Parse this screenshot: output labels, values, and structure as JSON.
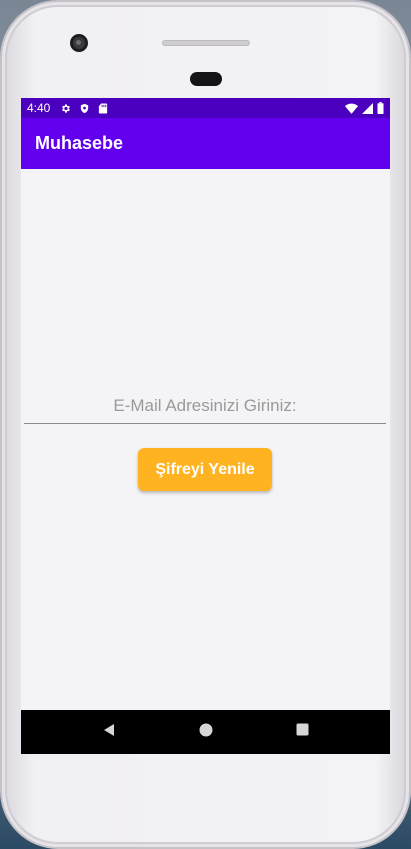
{
  "status_bar": {
    "time": "4:40",
    "left_icons": [
      "gear-icon",
      "shield-icon",
      "sd-card-icon"
    ],
    "right_icons": [
      "wifi-icon",
      "signal-icon",
      "battery-icon"
    ],
    "background": "#4b00bf"
  },
  "app_bar": {
    "title": "Muhasebe",
    "background": "#6200ee"
  },
  "form": {
    "email_placeholder": "E-Mail Adresinizi Giriniz:",
    "email_value": "",
    "reset_button_label": "Şifreyi Yenile",
    "reset_button_color": "#ffb320"
  },
  "nav_bar": {
    "buttons": [
      "back-icon",
      "home-icon",
      "recents-icon"
    ]
  }
}
